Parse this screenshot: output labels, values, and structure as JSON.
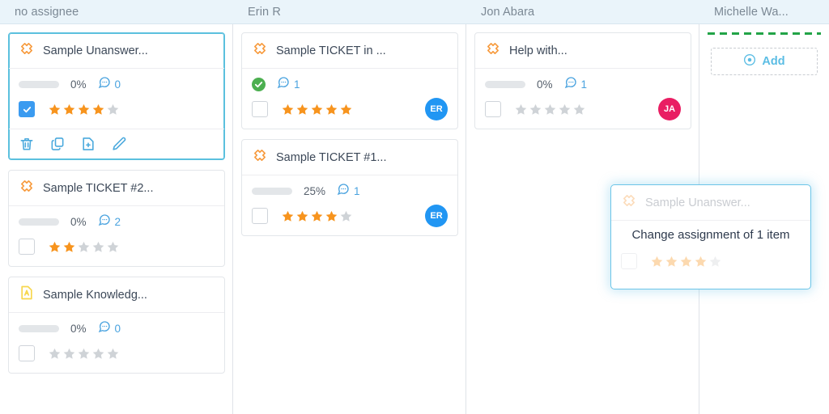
{
  "board": {
    "columns": [
      {
        "id": "no-assignee",
        "title": "no assignee",
        "cards": [
          {
            "id": "c1",
            "icon": "ticket-icon",
            "title": "Sample Unanswer...",
            "progress_label": "0%",
            "progress_value": 0,
            "status_icon": "progress-bar",
            "comments_icon": "comment-bubble-icon",
            "comments_count": "0",
            "checked": true,
            "rating": 4,
            "avatar": null,
            "selected": true,
            "actions": [
              {
                "name": "delete-icon",
                "label": "Delete"
              },
              {
                "name": "copy-icon",
                "label": "Copy"
              },
              {
                "name": "new-document-icon",
                "label": "New"
              },
              {
                "name": "edit-pencil-icon",
                "label": "Edit"
              }
            ]
          },
          {
            "id": "c2",
            "icon": "ticket-icon",
            "title": "Sample TICKET #2...",
            "progress_label": "0%",
            "progress_value": 0,
            "status_icon": "progress-bar",
            "comments_icon": "comment-bubble-icon",
            "comments_count": "2",
            "checked": false,
            "rating": 2,
            "avatar": null,
            "selected": false,
            "actions": []
          },
          {
            "id": "c3",
            "icon": "knowledge-base-icon",
            "title": "Sample Knowledg...",
            "progress_label": "0%",
            "progress_value": 0,
            "status_icon": "progress-bar",
            "comments_icon": "comment-bubble-icon",
            "comments_count": "0",
            "checked": false,
            "rating": 0,
            "avatar": null,
            "selected": false,
            "actions": []
          }
        ]
      },
      {
        "id": "erin-r",
        "title": "Erin R",
        "cards": [
          {
            "id": "c4",
            "icon": "ticket-icon",
            "title": "Sample TICKET in ...",
            "progress_label": "",
            "progress_value": 100,
            "status_icon": "green-check-circle-icon",
            "comments_icon": "comment-bubble-icon",
            "comments_count": "1",
            "checked": false,
            "rating": 5,
            "avatar": {
              "initials": "ER",
              "color": "#2196f3"
            },
            "selected": false,
            "actions": []
          },
          {
            "id": "c5",
            "icon": "ticket-icon",
            "title": "Sample TICKET #1...",
            "progress_label": "25%",
            "progress_value": 25,
            "status_icon": "progress-bar",
            "comments_icon": "comment-bubble-icon",
            "comments_count": "1",
            "checked": false,
            "rating": 4,
            "avatar": {
              "initials": "ER",
              "color": "#2196f3"
            },
            "selected": false,
            "actions": []
          }
        ]
      },
      {
        "id": "jon-abara",
        "title": "Jon Abara",
        "cards": [
          {
            "id": "c6",
            "icon": "ticket-icon",
            "title": "Help with...",
            "progress_label": "0%",
            "progress_value": 0,
            "status_icon": "progress-bar",
            "comments_icon": "comment-bubble-icon",
            "comments_count": "1",
            "checked": false,
            "rating": 0,
            "avatar": {
              "initials": "JA",
              "color": "#e91e63"
            },
            "selected": false,
            "actions": []
          }
        ]
      },
      {
        "id": "michelle-wa",
        "title": "Michelle Wa...",
        "cards": [],
        "drop_indicator": true,
        "add_button": {
          "label": "Add",
          "icon": "add-circle-icon"
        }
      }
    ]
  },
  "drag_ghost": {
    "icon": "ticket-icon",
    "title": "Sample Unanswer...",
    "message": "Change assignment of 1 item",
    "rating": 4,
    "checked": false
  },
  "colors": {
    "header_bg": "#eaf4fa",
    "header_text": "#7b8894",
    "accent_blue": "#5bbde4",
    "star_on": "#f7941e",
    "star_off": "#cfd3d7",
    "progress_green": "#5cbd5c",
    "drop_green": "#22a447",
    "selected_border": "#5bc0de"
  }
}
